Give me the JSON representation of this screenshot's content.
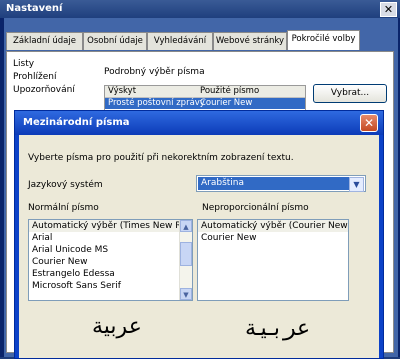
{
  "settings": {
    "title": "Nastavení",
    "close_glyph": "✕",
    "tabs": [
      "Základní údaje",
      "Osobní údaje",
      "Vyhledávání",
      "Webové stránky",
      "Pokročilé volby"
    ],
    "side_items": [
      "Listy",
      "Prohlížení",
      "Upozorňování"
    ],
    "section_label": "Podrobný výběr písma",
    "table": {
      "col1": "Výskyt",
      "col2": "Použité písmo",
      "row1_col1": "Prosté poštovní zprávy",
      "row1_col2": "Courier New"
    },
    "choose_button": "Vybrat..."
  },
  "dialog": {
    "title": "Mezinárodní písma",
    "close_glyph": "✕",
    "instruction": "Vyberte písma pro použití při nekorektním zobrazení textu.",
    "language_label": "Jazykový systém",
    "language_value": "Arabština",
    "normal_label": "Normální písmo",
    "mono_label": "Neproporcionální písmo",
    "normal_fonts": [
      "Automatický výběr (Times New R...",
      "Arial",
      "Arial Unicode MS",
      "Courier New",
      "Estrangelo Edessa",
      "Microsoft Sans Serif"
    ],
    "mono_fonts": [
      "Automatický výběr (Courier New)",
      "Courier New"
    ],
    "sample_normal": "عربية",
    "sample_mono": "عربية"
  }
}
